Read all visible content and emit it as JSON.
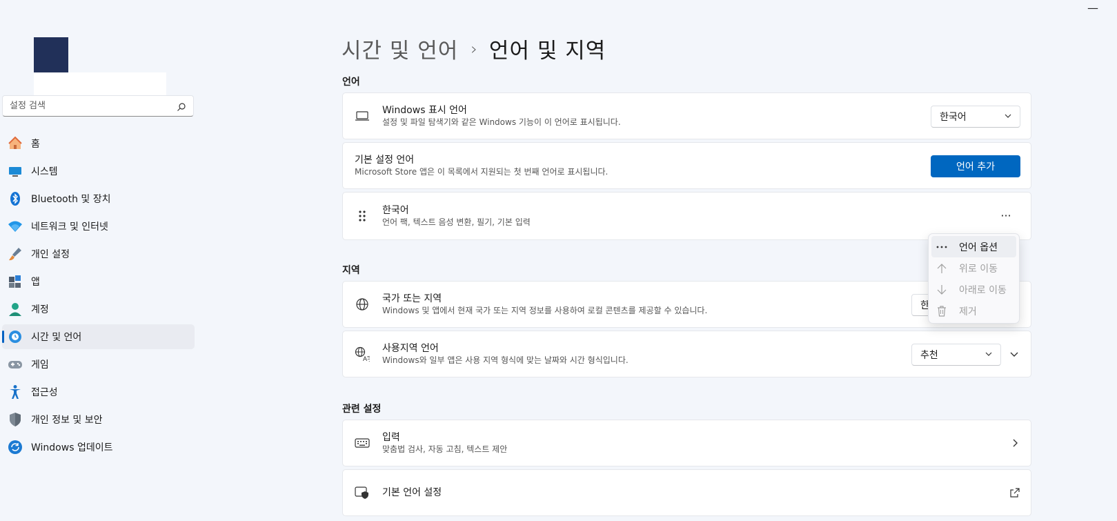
{
  "window": {
    "minimize_glyph": "—"
  },
  "search": {
    "placeholder": "설정 검색"
  },
  "nav": {
    "items": [
      {
        "label": "홈",
        "icon": "home-icon"
      },
      {
        "label": "시스템",
        "icon": "system-icon"
      },
      {
        "label": "Bluetooth 및 장치",
        "icon": "bluetooth-icon"
      },
      {
        "label": "네트워크 및 인터넷",
        "icon": "wifi-icon"
      },
      {
        "label": "개인 설정",
        "icon": "brush-icon"
      },
      {
        "label": "앱",
        "icon": "apps-icon"
      },
      {
        "label": "계정",
        "icon": "account-icon"
      },
      {
        "label": "시간 및 언어",
        "icon": "time-language-icon",
        "active": true
      },
      {
        "label": "게임",
        "icon": "gamepad-icon"
      },
      {
        "label": "접근성",
        "icon": "accessibility-icon"
      },
      {
        "label": "개인 정보 및 보안",
        "icon": "shield-icon"
      },
      {
        "label": "Windows 업데이트",
        "icon": "update-icon"
      }
    ]
  },
  "breadcrumb": {
    "parent": "시간 및 언어",
    "separator": "›",
    "current": "언어 및 지역"
  },
  "sections": {
    "language": "언어",
    "region": "지역",
    "related": "관련 설정"
  },
  "display_language": {
    "title": "Windows 표시 언어",
    "desc": "설정 및 파일 탐색기와 같은 Windows 기능이 이 언어로 표시됩니다.",
    "value": "한국어"
  },
  "preferred_language": {
    "title": "기본 설정 언어",
    "desc": "Microsoft Store 앱은 이 목록에서 지원되는 첫 번째 언어로 표시됩니다.",
    "button": "언어 추가"
  },
  "korean": {
    "title": "한국어",
    "desc": "언어 팩, 텍스트 음성 변환, 필기, 기본 입력",
    "more": "···"
  },
  "context_menu": {
    "options": "언어 옵션",
    "move_up": "위로 이동",
    "move_down": "아래로 이동",
    "remove": "제거"
  },
  "country": {
    "title": "국가 또는 지역",
    "desc": "Windows 및 앱에서 현재 국가 또는 지역 정보를 사용하여 로컬 콘텐츠를 제공할 수 있습니다.",
    "value_partial": "한"
  },
  "regional_format": {
    "title": "사용지역 언어",
    "desc": "Windows와 일부 앱은 사용 지역 형식에 맞는 날짜와 시간 형식입니다.",
    "value": "추천"
  },
  "typing": {
    "title": "입력",
    "desc": "맞춤법 검사, 자동 고침, 텍스트 제안"
  },
  "admin_language": {
    "title": "기본 언어 설정"
  },
  "colors": {
    "accent": "#0067c0",
    "avatar": "#213059"
  }
}
